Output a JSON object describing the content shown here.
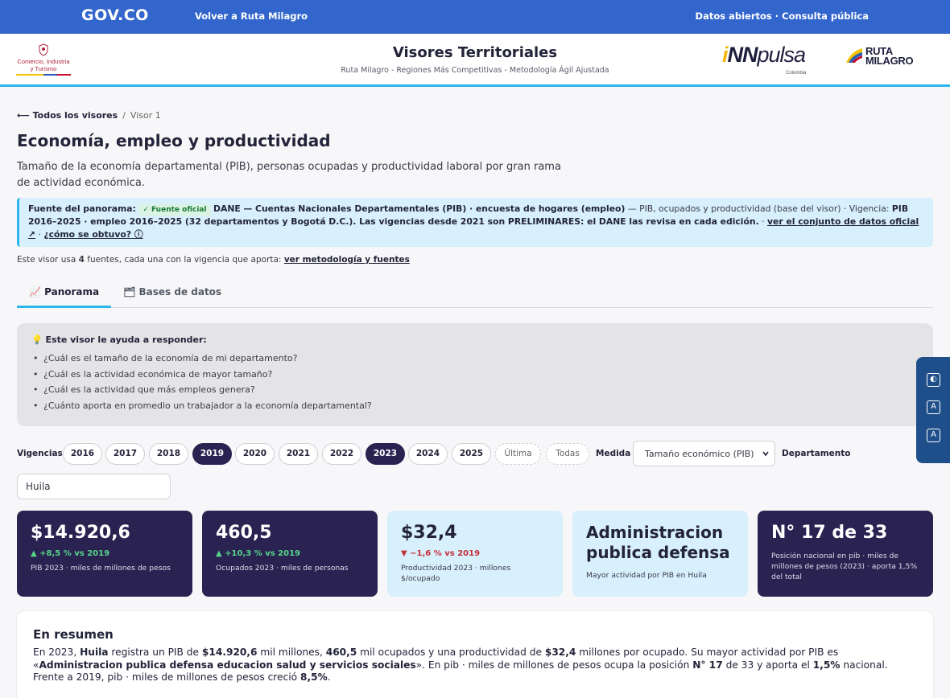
{
  "topbar": {
    "logo": "GOV.CO",
    "back_link": "Volver a Ruta Milagro",
    "right_links": "Datos abiertos · Consulta pública"
  },
  "header": {
    "ministry_text": "Comercio, Industria y Turismo",
    "title": "Visores Territoriales",
    "subtitle": "Ruta Milagro - Regiones Más Competitivas - Metodología Ágil Ajustada",
    "innpulsa_i": "i",
    "innpulsa_nn": "NN",
    "innpulsa_rest": "pulsa",
    "innpulsa_sub": "Colombia",
    "ruta_line1": "RUTA",
    "ruta_line2": "MILAGRO"
  },
  "breadcrumb": {
    "back": "⟵ Todos los visores",
    "sep": "/",
    "current": "Visor 1"
  },
  "page": {
    "title": "Economía, empleo y productividad",
    "description": "Tamaño de la economía departamental (PIB), personas ocupadas y productividad laboral por gran rama de actividad económica."
  },
  "source": {
    "label": "Fuente del panorama:",
    "badge": "✓ Fuente oficial",
    "entity": "DANE — Cuentas Nacionales Departamentales (PIB) · encuesta de hogares (empleo)",
    "details": " — PIB, ocupados y productividad (base del visor) · Vigencia: ",
    "vigencia": "PIB 2016–2025 · empleo 2016–2025 (32 departamentos y Bogotá D.C.). Las vigencias desde 2021 son PRELIMINARES: el DANE las revisa en cada edición.",
    "sep": " · ",
    "link_dataset": "ver el conjunto de datos oficial ↗",
    "link_how": "¿cómo se obtuvo? ⓘ"
  },
  "sources_note": {
    "prefix": "Este visor usa ",
    "count": "4",
    "suffix": " fuentes, cada una con la vigencia que aporta: ",
    "link": "ver metodología y fuentes"
  },
  "tabs": [
    {
      "label": "📈 Panorama",
      "active": true
    },
    {
      "label": "🗂 Bases de datos",
      "active": false
    }
  ],
  "help": {
    "title": "💡 Este visor le ayuda a responder:",
    "questions": [
      "¿Cuál es el tamaño de la economía de mi departamento?",
      "¿Cuál es la actividad económica de mayor tamaño?",
      "¿Cuál es la actividad que más empleos genera?",
      "¿Cuánto aporta en promedio un trabajador a la economía departamental?"
    ]
  },
  "filters": {
    "years_label": "Vigencias",
    "years": [
      "2016",
      "2017",
      "2018",
      "2019",
      "2020",
      "2021",
      "2022",
      "2023",
      "2024",
      "2025"
    ],
    "selected_years": [
      "2019",
      "2023"
    ],
    "extra_options": [
      "Última",
      "Todas"
    ],
    "measure_label": "Medida",
    "measure_value": "Tamaño económico (PIB)",
    "department_label": "Departamento",
    "department_value": "Huila"
  },
  "kpis": [
    {
      "value": "$14.920,6",
      "delta": "▲ +8,5 % vs 2019",
      "caption": "PIB 2023 · miles de millones de pesos"
    },
    {
      "value": "460,5",
      "delta": "▲ +10,3 % vs 2019",
      "caption": "Ocupados 2023 · miles de personas"
    },
    {
      "value": "$32,4",
      "delta": "▼ −1,6 % vs 2019",
      "caption": "Productividad 2023 · millones $/ocupado"
    },
    {
      "value": "Administracion publica defensa",
      "caption": "Mayor actividad por PIB en Huila"
    },
    {
      "value": "N° 17 de 33",
      "caption": "Posición nacional en pib · miles de millones de pesos (2023) · aporta 1,5% del total"
    }
  ],
  "summary": {
    "title": "En resumen",
    "t1": "En 2023, ",
    "dept": "Huila",
    "t2": " registra un PIB de ",
    "pib": "$14.920,6",
    "t3": " mil millones, ",
    "ocupados": "460,5",
    "t4": " mil ocupados y una productividad de ",
    "productividad": "$32,4",
    "t5": " millones por ocupado. Su mayor actividad por PIB es «",
    "actividad": "Administracion publica defensa educacion salud y servicios sociales",
    "t6": "». En pib · miles de millones de pesos ocupa la posición ",
    "posicion": "N° 17",
    "t7": " de 33 y aporta el ",
    "aporte": "1,5%",
    "t8": " nacional. Frente a 2019, pib · miles de millones de pesos creció ",
    "crecimiento": "8,5%",
    "t9": "."
  },
  "a11y": {
    "contrast": "◐",
    "font_down": "A",
    "font_up": "A"
  },
  "colors": {
    "topbar": "#3366cc",
    "accent": "#2ab6ea",
    "dark_card": "#2a2352",
    "light_card": "#d7f0fb"
  }
}
